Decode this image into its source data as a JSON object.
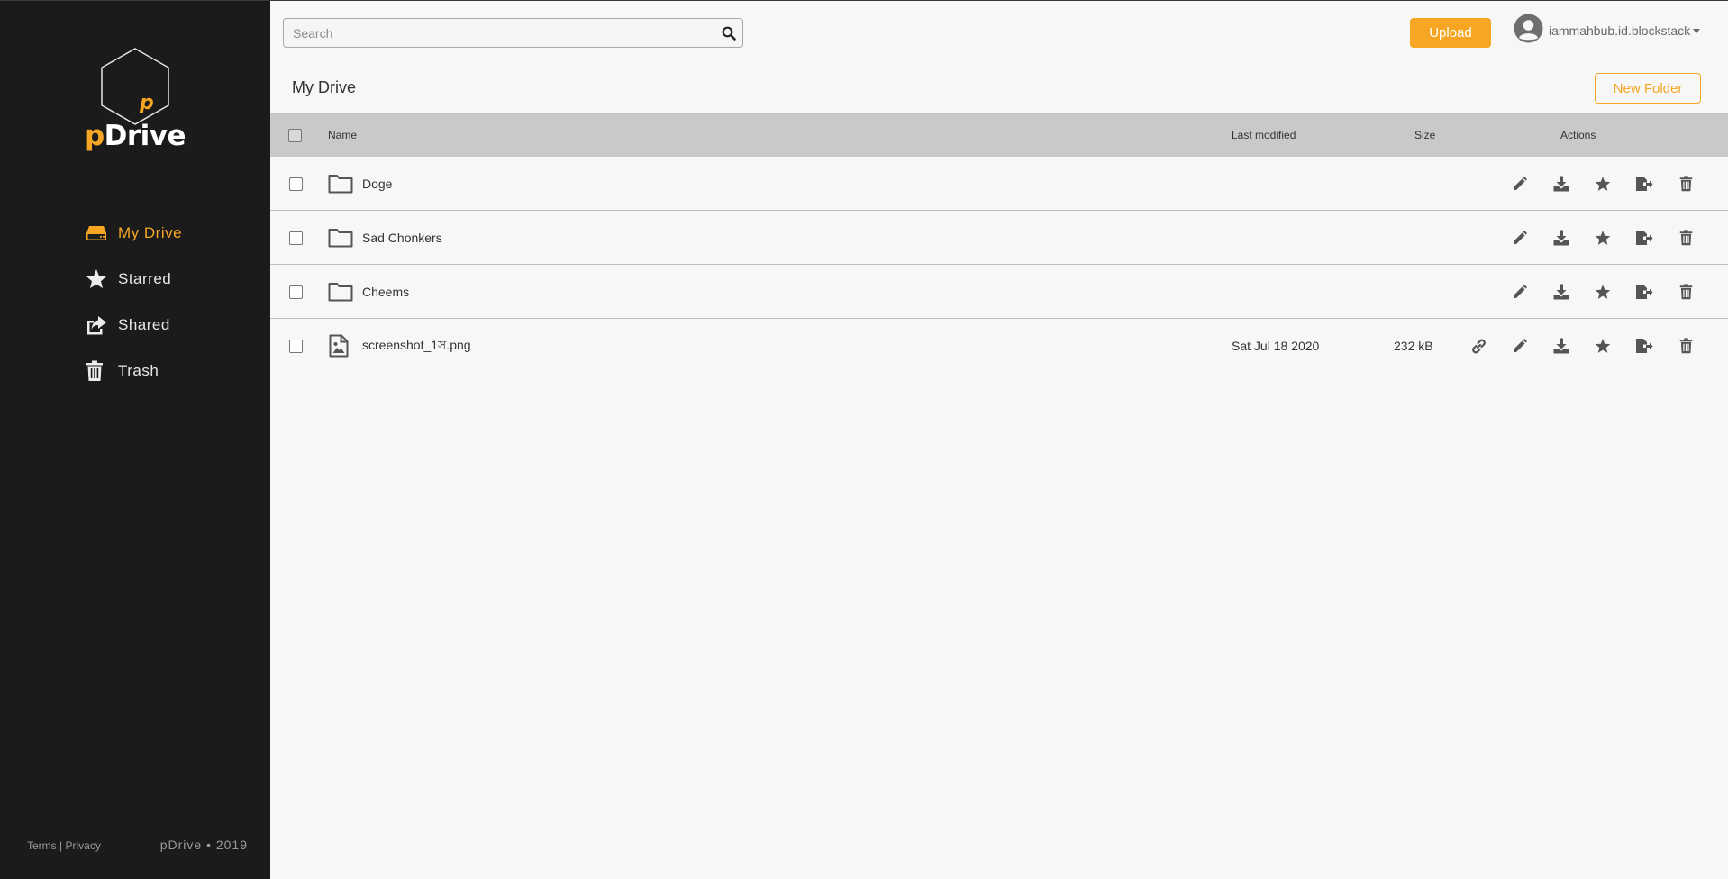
{
  "brand": {
    "name": "pDrive",
    "name_accent": "p",
    "name_rest": "Drive",
    "footer_copy": "pDrive • 2019",
    "accent_color": "#f6a623"
  },
  "sidebar": {
    "items": [
      {
        "label": "My Drive",
        "icon": "drive-icon",
        "active": true
      },
      {
        "label": "Starred",
        "icon": "star-icon",
        "active": false
      },
      {
        "label": "Shared",
        "icon": "share-icon",
        "active": false
      },
      {
        "label": "Trash",
        "icon": "trash-icon",
        "active": false
      }
    ],
    "footer": {
      "terms": "Terms",
      "separator": "|",
      "privacy": "Privacy"
    }
  },
  "search": {
    "placeholder": "Search",
    "value": ""
  },
  "header": {
    "upload_label": "Upload",
    "username": "iammahbub.id.blockstack"
  },
  "main": {
    "title": "My Drive",
    "new_folder_label": "New Folder",
    "columns": {
      "name": "Name",
      "last_modified": "Last modified",
      "size": "Size",
      "actions": "Actions"
    },
    "rows": [
      {
        "type": "folder",
        "name": "Doge",
        "last_modified": "",
        "size": ""
      },
      {
        "type": "folder",
        "name": "Sad Chonkers",
        "last_modified": "",
        "size": ""
      },
      {
        "type": "folder",
        "name": "Cheems",
        "last_modified": "",
        "size": ""
      },
      {
        "type": "file",
        "name": "screenshot_1স.png",
        "last_modified": "Sat Jul 18 2020",
        "size": "232 kB"
      }
    ]
  }
}
